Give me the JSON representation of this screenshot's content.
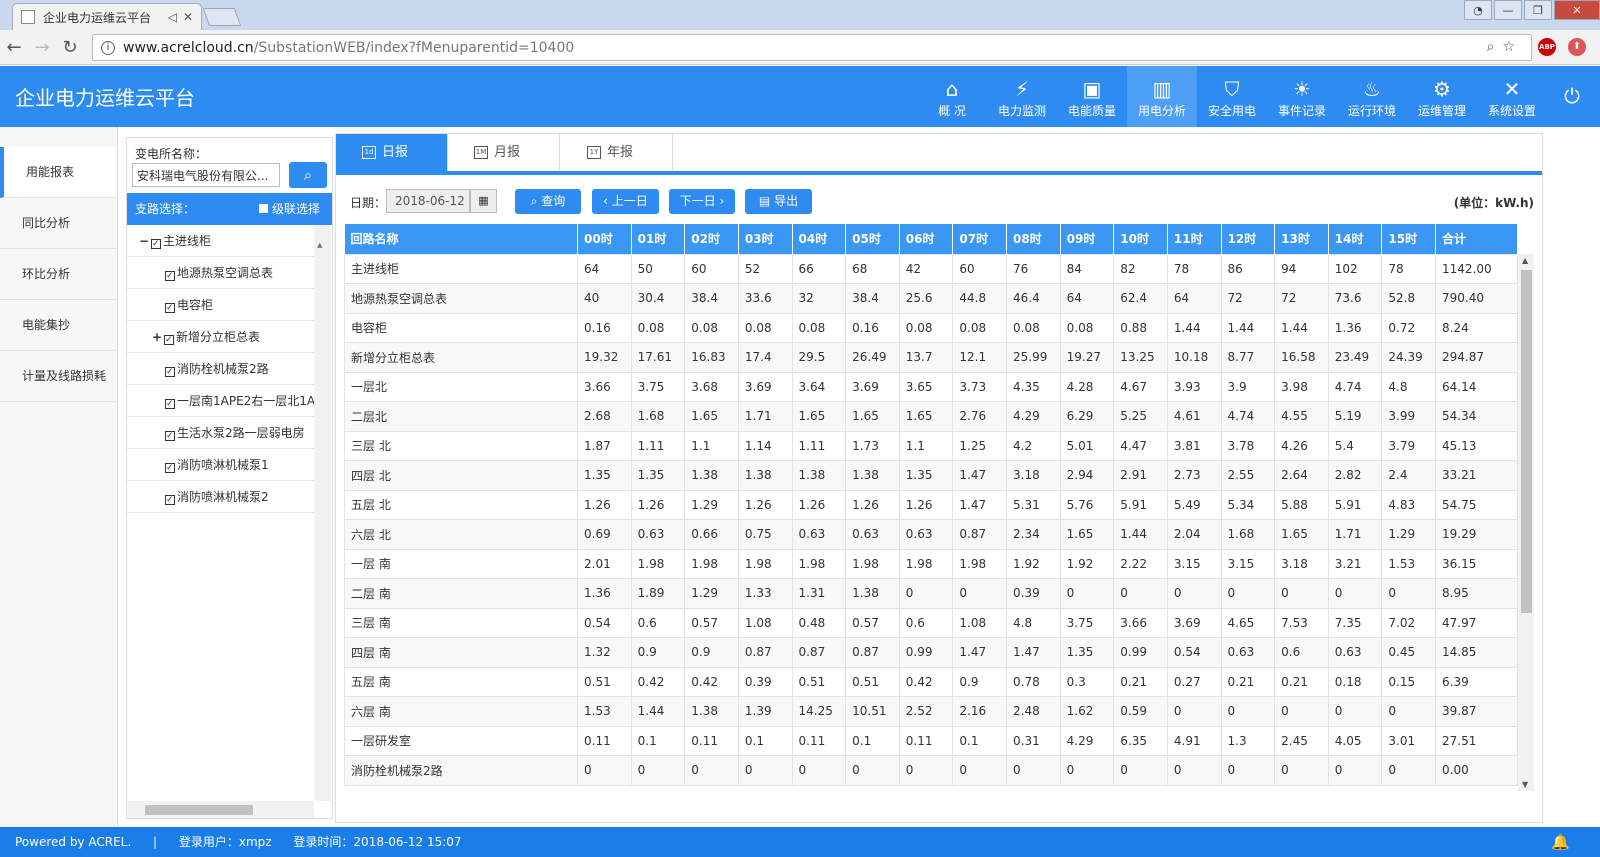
{
  "browser": {
    "tab_title": "企业电力运维云平台",
    "url_host": "www.acrelcloud.cn",
    "url_path": "/SubstationWEB/index?fMenuparentid=10400",
    "abp_label": "ABP"
  },
  "app": {
    "title": "企业电力运维云平台"
  },
  "topnav": [
    {
      "label": "概 况",
      "icon": "home-icon"
    },
    {
      "label": "电力监测",
      "icon": "plug-icon"
    },
    {
      "label": "电能质量",
      "icon": "waveform-icon"
    },
    {
      "label": "用电分析",
      "icon": "bar-chart-icon"
    },
    {
      "label": "安全用电",
      "icon": "shield-icon"
    },
    {
      "label": "事件记录",
      "icon": "alarm-light-icon"
    },
    {
      "label": "运行环境",
      "icon": "thermometer-icon"
    },
    {
      "label": "运维管理",
      "icon": "gears-icon"
    },
    {
      "label": "系统设置",
      "icon": "tools-icon"
    }
  ],
  "sidebar": {
    "items": [
      "用能报表",
      "同比分析",
      "环比分析",
      "电能集抄",
      "计量及线路损耗"
    ]
  },
  "tree": {
    "substation_label": "变电所名称：",
    "substation_value": "安科瑞电气股份有限公...",
    "branch_label": "支路选择：",
    "cascade_label": "级联选择",
    "nodes": [
      "主进线柜",
      "地源热泵空调总表",
      "电容柜",
      "新增分立柜总表",
      "消防栓机械泵2路",
      "一层南1APE2右一层北1A",
      "生活水泵2路一层弱电房",
      "消防喷淋机械泵1",
      "消防喷淋机械泵2"
    ],
    "expand_minus": "−",
    "expand_plus": "+"
  },
  "report_tabs": [
    {
      "label": "日报",
      "cal": "1d"
    },
    {
      "label": "月报",
      "cal": "1M"
    },
    {
      "label": "年报",
      "cal": "1Y"
    }
  ],
  "toolbar": {
    "date_label": "日期：",
    "date_value": "2018-06-12",
    "query": "查询",
    "prev": "上一日",
    "next": "下一日",
    "export": "导出",
    "unit": "(单位：kW.h)"
  },
  "table": {
    "headers": [
      "回路名称",
      "00时",
      "01时",
      "02时",
      "03时",
      "04时",
      "05时",
      "06时",
      "07时",
      "08时",
      "09时",
      "10时",
      "11时",
      "12时",
      "13时",
      "14时",
      "15时",
      "合计"
    ],
    "rows": [
      [
        "主进线柜",
        "64",
        "50",
        "60",
        "52",
        "66",
        "68",
        "42",
        "60",
        "76",
        "84",
        "82",
        "78",
        "86",
        "94",
        "102",
        "78",
        "1142.00"
      ],
      [
        "地源热泵空调总表",
        "40",
        "30.4",
        "38.4",
        "33.6",
        "32",
        "38.4",
        "25.6",
        "44.8",
        "46.4",
        "64",
        "62.4",
        "64",
        "72",
        "72",
        "73.6",
        "52.8",
        "790.40"
      ],
      [
        "电容柜",
        "0.16",
        "0.08",
        "0.08",
        "0.08",
        "0.08",
        "0.16",
        "0.08",
        "0.08",
        "0.08",
        "0.08",
        "0.88",
        "1.44",
        "1.44",
        "1.44",
        "1.36",
        "0.72",
        "8.24"
      ],
      [
        "新增分立柜总表",
        "19.32",
        "17.61",
        "16.83",
        "17.4",
        "29.5",
        "26.49",
        "13.7",
        "12.1",
        "25.99",
        "19.27",
        "13.25",
        "10.18",
        "8.77",
        "16.58",
        "23.49",
        "24.39",
        "294.87"
      ],
      [
        "一层北",
        "3.66",
        "3.75",
        "3.68",
        "3.69",
        "3.64",
        "3.69",
        "3.65",
        "3.73",
        "4.35",
        "4.28",
        "4.67",
        "3.93",
        "3.9",
        "3.98",
        "4.74",
        "4.8",
        "64.14"
      ],
      [
        "二层北",
        "2.68",
        "1.68",
        "1.65",
        "1.71",
        "1.65",
        "1.65",
        "1.65",
        "2.76",
        "4.29",
        "6.29",
        "5.25",
        "4.61",
        "4.74",
        "4.55",
        "5.19",
        "3.99",
        "54.34"
      ],
      [
        "三层 北",
        "1.87",
        "1.11",
        "1.1",
        "1.14",
        "1.11",
        "1.73",
        "1.1",
        "1.25",
        "4.2",
        "5.01",
        "4.47",
        "3.81",
        "3.78",
        "4.26",
        "5.4",
        "3.79",
        "45.13"
      ],
      [
        "四层 北",
        "1.35",
        "1.35",
        "1.38",
        "1.38",
        "1.38",
        "1.38",
        "1.35",
        "1.47",
        "3.18",
        "2.94",
        "2.91",
        "2.73",
        "2.55",
        "2.64",
        "2.82",
        "2.4",
        "33.21"
      ],
      [
        "五层 北",
        "1.26",
        "1.26",
        "1.29",
        "1.26",
        "1.26",
        "1.26",
        "1.26",
        "1.47",
        "5.31",
        "5.76",
        "5.91",
        "5.49",
        "5.34",
        "5.88",
        "5.91",
        "4.83",
        "54.75"
      ],
      [
        "六层 北",
        "0.69",
        "0.63",
        "0.66",
        "0.75",
        "0.63",
        "0.63",
        "0.63",
        "0.87",
        "2.34",
        "1.65",
        "1.44",
        "2.04",
        "1.68",
        "1.65",
        "1.71",
        "1.29",
        "19.29"
      ],
      [
        "一层 南",
        "2.01",
        "1.98",
        "1.98",
        "1.98",
        "1.98",
        "1.98",
        "1.98",
        "1.98",
        "1.92",
        "1.92",
        "2.22",
        "3.15",
        "3.15",
        "3.18",
        "3.21",
        "1.53",
        "36.15"
      ],
      [
        "二层 南",
        "1.36",
        "1.89",
        "1.29",
        "1.33",
        "1.31",
        "1.38",
        "0",
        "0",
        "0.39",
        "0",
        "0",
        "0",
        "0",
        "0",
        "0",
        "0",
        "8.95"
      ],
      [
        "三层 南",
        "0.54",
        "0.6",
        "0.57",
        "1.08",
        "0.48",
        "0.57",
        "0.6",
        "1.08",
        "4.8",
        "3.75",
        "3.66",
        "3.69",
        "4.65",
        "7.53",
        "7.35",
        "7.02",
        "47.97"
      ],
      [
        "四层 南",
        "1.32",
        "0.9",
        "0.9",
        "0.87",
        "0.87",
        "0.87",
        "0.99",
        "1.47",
        "1.47",
        "1.35",
        "0.99",
        "0.54",
        "0.63",
        "0.6",
        "0.63",
        "0.45",
        "14.85"
      ],
      [
        "五层 南",
        "0.51",
        "0.42",
        "0.42",
        "0.39",
        "0.51",
        "0.51",
        "0.42",
        "0.9",
        "0.78",
        "0.3",
        "0.21",
        "0.27",
        "0.21",
        "0.21",
        "0.18",
        "0.15",
        "6.39"
      ],
      [
        "六层 南",
        "1.53",
        "1.44",
        "1.38",
        "1.39",
        "14.25",
        "10.51",
        "2.52",
        "2.16",
        "2.48",
        "1.62",
        "0.59",
        "0",
        "0",
        "0",
        "0",
        "0",
        "39.87"
      ],
      [
        "一层研发室",
        "0.11",
        "0.1",
        "0.11",
        "0.1",
        "0.11",
        "0.1",
        "0.11",
        "0.1",
        "0.31",
        "4.29",
        "6.35",
        "4.91",
        "1.3",
        "2.45",
        "4.05",
        "3.01",
        "27.51"
      ],
      [
        "消防栓机械泵2路",
        "0",
        "0",
        "0",
        "0",
        "0",
        "0",
        "0",
        "0",
        "0",
        "0",
        "0",
        "0",
        "0",
        "0",
        "0",
        "0",
        "0.00"
      ]
    ]
  },
  "footer": {
    "powered": "Powered by ACREL.",
    "sep": "|",
    "user_label": "登录用户：xmpz",
    "login_time": "登录时间：2018-06-12 15:07"
  },
  "colors": {
    "brand_blue": "#2e8bf2",
    "header_blue": "#3a97f4",
    "footer_blue": "#1a7ee8"
  }
}
